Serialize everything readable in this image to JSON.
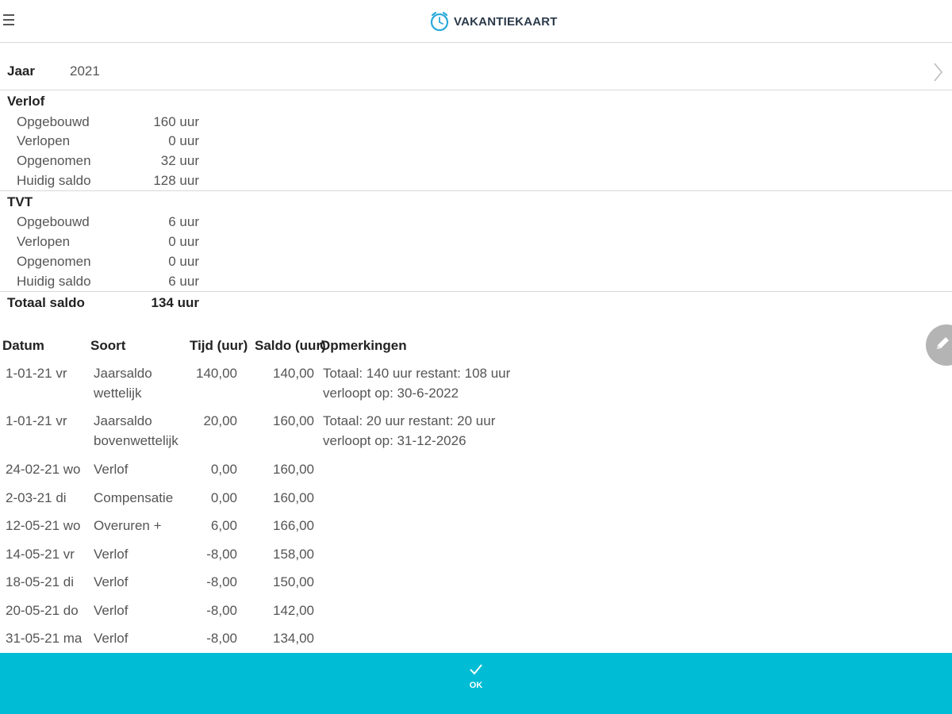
{
  "header": {
    "title": "VAKANTIEKAART",
    "menu_icon": "hamburger-menu-icon",
    "logo_icon": "clock-logo-icon"
  },
  "year": {
    "label": "Jaar",
    "value": "2021"
  },
  "verlof": {
    "title": "Verlof",
    "rows": [
      {
        "label": "Opgebouwd",
        "value": "160 uur"
      },
      {
        "label": "Verlopen",
        "value": "0 uur"
      },
      {
        "label": "Opgenomen",
        "value": "32 uur"
      },
      {
        "label": "Huidig saldo",
        "value": "128 uur"
      }
    ]
  },
  "tvt": {
    "title": "TVT",
    "rows": [
      {
        "label": "Opgebouwd",
        "value": "6 uur"
      },
      {
        "label": "Verlopen",
        "value": "0 uur"
      },
      {
        "label": "Opgenomen",
        "value": "0 uur"
      },
      {
        "label": "Huidig saldo",
        "value": "6 uur"
      }
    ]
  },
  "totaal": {
    "label": "Totaal saldo",
    "value": "134 uur"
  },
  "table": {
    "headers": {
      "datum": "Datum",
      "soort": "Soort",
      "tijd": "Tijd (uur)",
      "saldo": "Saldo (uur)",
      "opmerkingen": "Opmerkingen"
    },
    "rows": [
      {
        "datum": "1-01-21 vr",
        "soort": [
          "Jaarsaldo",
          "wettelijk"
        ],
        "tijd": "140,00",
        "saldo": "140,00",
        "opmerkingen": [
          "Totaal: 140 uur restant: 108 uur",
          "verloopt op: 30-6-2022"
        ]
      },
      {
        "datum": "1-01-21 vr",
        "soort": [
          "Jaarsaldo",
          "bovenwettelijk"
        ],
        "tijd": "20,00",
        "saldo": "160,00",
        "opmerkingen": [
          "Totaal: 20 uur restant: 20 uur",
          "verloopt op: 31-12-2026"
        ]
      },
      {
        "datum": "24-02-21 wo",
        "soort": [
          "Verlof"
        ],
        "tijd": "0,00",
        "saldo": "160,00",
        "opmerkingen": []
      },
      {
        "datum": "2-03-21 di",
        "soort": [
          "Compensatie"
        ],
        "tijd": "0,00",
        "saldo": "160,00",
        "opmerkingen": []
      },
      {
        "datum": "12-05-21 wo",
        "soort": [
          "Overuren +"
        ],
        "tijd": "6,00",
        "saldo": "166,00",
        "opmerkingen": []
      },
      {
        "datum": "14-05-21 vr",
        "soort": [
          "Verlof"
        ],
        "tijd": "-8,00",
        "saldo": "158,00",
        "opmerkingen": []
      },
      {
        "datum": "18-05-21 di",
        "soort": [
          "Verlof"
        ],
        "tijd": "-8,00",
        "saldo": "150,00",
        "opmerkingen": []
      },
      {
        "datum": "20-05-21 do",
        "soort": [
          "Verlof"
        ],
        "tijd": "-8,00",
        "saldo": "142,00",
        "opmerkingen": []
      },
      {
        "datum": "31-05-21 ma",
        "soort": [
          "Verlof"
        ],
        "tijd": "-8,00",
        "saldo": "134,00",
        "opmerkingen": []
      }
    ]
  },
  "actions": {
    "edit_icon": "pencil-icon",
    "ok_icon": "checkmark-icon",
    "ok_label": "OK"
  },
  "colors": {
    "accent": "#00bcd4",
    "logo": "#29a9d9",
    "edit_button": "#b4b4b4"
  }
}
